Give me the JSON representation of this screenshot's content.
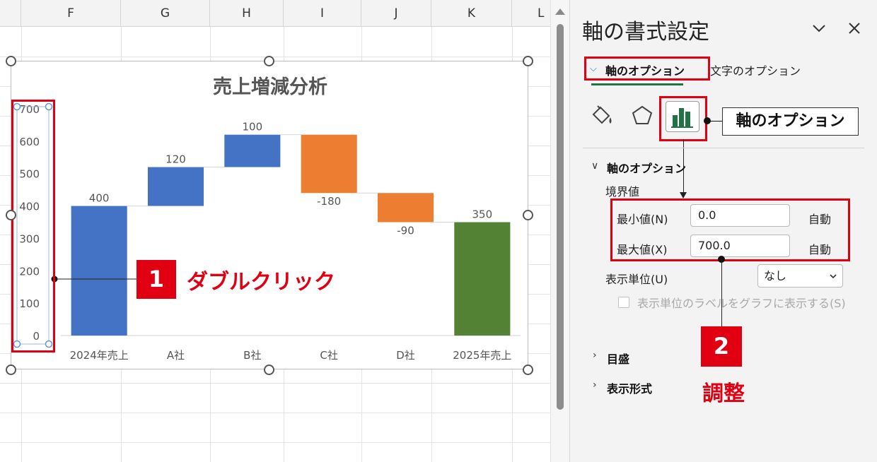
{
  "sheet": {
    "columns": [
      "F",
      "G",
      "H",
      "I",
      "J",
      "K",
      "L"
    ]
  },
  "chart": {
    "selected_element": "vertical-axis"
  },
  "chart_data": {
    "type": "bar",
    "title": "売上増減分析",
    "categories": [
      "2024年売上",
      "A社",
      "B社",
      "C社",
      "D社",
      "2025年売上"
    ],
    "values": [
      400,
      120,
      100,
      -180,
      -90,
      350
    ],
    "data_labels": [
      "400",
      "120",
      "100",
      "-180",
      "-90",
      "350"
    ],
    "waterfall": true,
    "ylim": [
      0,
      700
    ],
    "yticks": [
      "0",
      "100",
      "200",
      "300",
      "400",
      "500",
      "600",
      "700"
    ],
    "colors": {
      "total_start": "#4472c4",
      "increase": "#4472c4",
      "decrease": "#ed7d31",
      "total_end": "#548235"
    },
    "grid": false,
    "legend": "none",
    "xlabel": "",
    "ylabel": ""
  },
  "annotations": {
    "step1_number": "1",
    "step1_text": "ダブルクリック",
    "step2_number": "2",
    "step2_text": "調整",
    "callout_text": "軸のオプション",
    "highlight_color": "#e00012"
  },
  "pane": {
    "title": "軸の書式設定",
    "tab_axis_options": "軸のオプション",
    "tab_text_options": "文字のオプション",
    "icons": [
      "fill-line-icon",
      "effects-pentagon-icon",
      "axis-options-bar-icon"
    ],
    "section_axis_options": "軸のオプション",
    "bounds_label": "境界値",
    "min_label": "最小値(N)",
    "min_value": "0.0",
    "min_auto": "自動",
    "max_label": "最大値(X)",
    "max_value": "700.0",
    "max_auto": "自動",
    "display_unit_label": "表示単位(U)",
    "display_unit_value": "なし",
    "show_unit_label_checkbox": "表示単位のラベルをグラフに表示する(S)",
    "section_tick_marks": "目盛",
    "section_number_format": "表示形式",
    "accent_color": "#217346"
  }
}
